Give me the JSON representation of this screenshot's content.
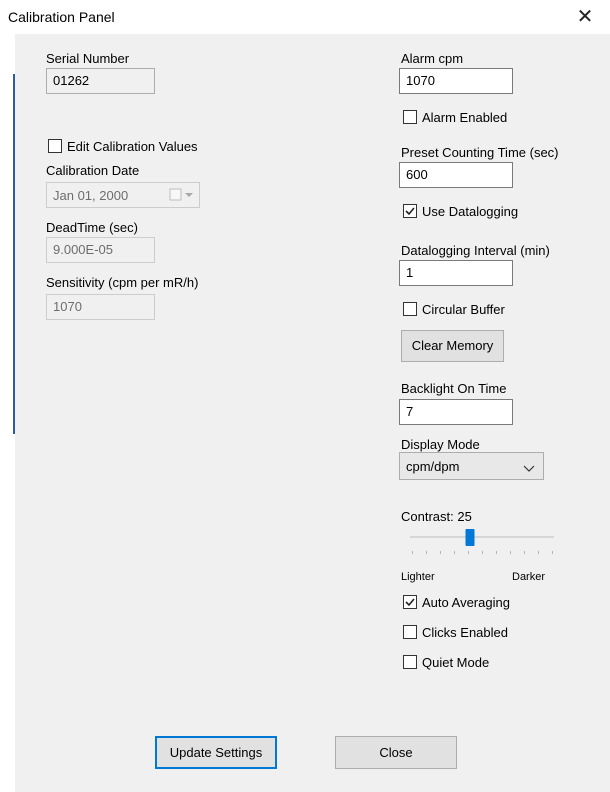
{
  "window": {
    "title": "Calibration Panel",
    "close_glyph": "✕"
  },
  "left": {
    "serial_label": "Serial Number",
    "serial_value": "01262",
    "edit_cal_label": "Edit Calibration Values",
    "edit_cal_checked": false,
    "cal_date_label": "Calibration Date",
    "cal_date_value": "Jan 01, 2000",
    "deadtime_label": "DeadTime (sec)",
    "deadtime_value": "9.000E-05",
    "sensitivity_label": "Sensitivity (cpm per mR/h)",
    "sensitivity_value": "1070"
  },
  "right": {
    "alarm_cpm_label": "Alarm cpm",
    "alarm_cpm_value": "1070",
    "alarm_enabled_label": "Alarm Enabled",
    "alarm_enabled_checked": false,
    "preset_label": "Preset Counting Time (sec)",
    "preset_value": "600",
    "use_datalogging_label": "Use Datalogging",
    "use_datalogging_checked": true,
    "interval_label": "Datalogging Interval (min)",
    "interval_value": "1",
    "circular_buffer_label": "Circular Buffer",
    "circular_buffer_checked": false,
    "clear_memory_label": "Clear Memory",
    "backlight_label": "Backlight On Time",
    "backlight_value": "7",
    "display_mode_label": "Display Mode",
    "display_mode_value": "cpm/dpm",
    "contrast_label": "Contrast: 25",
    "contrast_value": 25,
    "contrast_min_label": "Lighter",
    "contrast_max_label": "Darker",
    "auto_averaging_label": "Auto Averaging",
    "auto_averaging_checked": true,
    "clicks_enabled_label": "Clicks Enabled",
    "clicks_enabled_checked": false,
    "quiet_mode_label": "Quiet Mode",
    "quiet_mode_checked": false
  },
  "footer": {
    "update_label": "Update Settings",
    "close_label": "Close"
  },
  "colors": {
    "accent": "#0078d7",
    "window_bg": "#f0f0f0"
  },
  "icons": {
    "close": "close-icon",
    "calendar": "calendar-icon",
    "dropdown": "chevron-down-icon",
    "check": "check-icon"
  }
}
